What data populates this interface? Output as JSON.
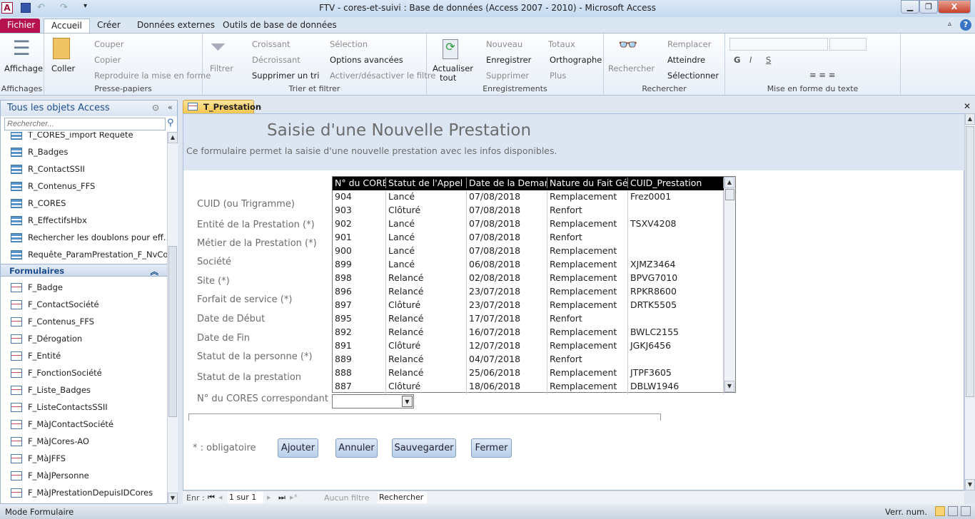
{
  "window": {
    "title": "FTV - cores-et-suivi : Base de données (Access 2007 - 2010)  -  Microsoft Access",
    "app_icon": "A"
  },
  "tabs": [
    "Fichier",
    "Accueil",
    "Créer",
    "Données externes",
    "Outils de base de données"
  ],
  "ribbon": {
    "affichages": {
      "button": "Affichage",
      "label": "Affichages"
    },
    "presse": {
      "coller": "Coller",
      "couper": "Couper",
      "copier": "Copier",
      "reproduire": "Reproduire la mise en forme",
      "label": "Presse-papiers"
    },
    "trier": {
      "filtrer": "Filtrer",
      "croissant": "Croissant",
      "decroissant": "Décroissant",
      "supprimer_tri": "Supprimer un tri",
      "selection": "Sélection",
      "options": "Options avancées",
      "activer": "Activer/désactiver le filtre",
      "label": "Trier et filtrer"
    },
    "enreg": {
      "actualiser": "Actualiser",
      "tout": "tout",
      "nouveau": "Nouveau",
      "enregistrer": "Enregistrer",
      "supprimer": "Supprimer",
      "totaux": "Totaux",
      "orthographe": "Orthographe",
      "plus": "Plus",
      "label": "Enregistrements"
    },
    "rechercher": {
      "button": "Rechercher",
      "remplacer": "Remplacer",
      "atteindre": "Atteindre",
      "selectionner": "Sélectionner",
      "label": "Rechercher"
    },
    "mise_en_forme": {
      "bold": "G",
      "italic": "I",
      "underline": "S",
      "label": "Mise en forme du texte"
    }
  },
  "nav": {
    "title": "Tous les objets Access",
    "search_placeholder": "Rechercher...",
    "queries": [
      "T_CORES_import Requête",
      "R_Badges",
      "R_ContactSSII",
      "R_Contenus_FFS",
      "R_CORES",
      "R_EffectifsHbx",
      "Rechercher les doublons pour eff...",
      "Requête_ParamPrestation_F_NvCo..."
    ],
    "forms_section": "Formulaires",
    "forms": [
      "F_Badge",
      "F_ContactSociété",
      "F_Contenus_FFS",
      "F_Dérogation",
      "F_Entité",
      "F_FonctionSociété",
      "F_Liste_Badges",
      "F_ListeContactsSSII",
      "F_MàJContactSociété",
      "F_MàJCores-AO",
      "F_MàJFFS",
      "F_MàJPersonne",
      "F_MàJPrestationDepuisIDCores"
    ]
  },
  "doc_tab": "T_Prestation",
  "form": {
    "title": "Saisie d'une Nouvelle Prestation",
    "subtitle": "Ce formulaire permet la saisie d'une nouvelle prestation avec les infos disponibles.",
    "labels": [
      "CUID (ou Trigramme)",
      "Entité de la Prestation (*)",
      "Métier de la Prestation (*)",
      "Société",
      "Site (*)",
      "Forfait de service (*)",
      "Date de Début",
      "Date de Fin",
      "Statut de la personne (*)",
      "Statut de la prestation",
      "N° du CORES correspondant"
    ],
    "required_note": "* : obligatoire",
    "buttons": [
      "Ajouter",
      "Annuler",
      "Sauvegarder",
      "Fermer"
    ],
    "list": {
      "columns": [
        "N° du CORES",
        "Statut de l'Appel d'",
        "Date de la Demande",
        "Nature du Fait Gén",
        "CUID_Prestation"
      ],
      "rows": [
        [
          "904",
          "Lancé",
          "07/08/2018",
          "Remplacement",
          "Frez0001"
        ],
        [
          "903",
          "Clôturé",
          "07/08/2018",
          "Renfort",
          ""
        ],
        [
          "902",
          "Lancé",
          "07/08/2018",
          "Remplacement",
          "TSXV4208"
        ],
        [
          "901",
          "Lancé",
          "07/08/2018",
          "Renfort",
          ""
        ],
        [
          "900",
          "Lancé",
          "07/08/2018",
          "Remplacement",
          ""
        ],
        [
          "899",
          "Lancé",
          "06/08/2018",
          "Remplacement",
          "XJMZ3464"
        ],
        [
          "898",
          "Relancé",
          "02/08/2018",
          "Remplacement",
          "BPVG7010"
        ],
        [
          "896",
          "Relancé",
          "23/07/2018",
          "Remplacement",
          "RPKR8600"
        ],
        [
          "897",
          "Clôturé",
          "23/07/2018",
          "Remplacement",
          "DRTK5505"
        ],
        [
          "895",
          "Relancé",
          "17/07/2018",
          "Renfort",
          ""
        ],
        [
          "892",
          "Relancé",
          "16/07/2018",
          "Remplacement",
          "BWLC2155"
        ],
        [
          "891",
          "Clôturé",
          "12/07/2018",
          "Remplacement",
          "JGKJ6456"
        ],
        [
          "889",
          "Relancé",
          "04/07/2018",
          "Renfort",
          ""
        ],
        [
          "888",
          "Relancé",
          "25/06/2018",
          "Remplacement",
          "JTPF3605"
        ],
        [
          "887",
          "Clôturé",
          "18/06/2018",
          "Remplacement",
          "DBLW1946"
        ]
      ]
    }
  },
  "record_nav": {
    "label": "Enr :",
    "position": "1 sur 1",
    "filter": "Aucun filtre",
    "search": "Rechercher"
  },
  "status": {
    "mode": "Mode Formulaire",
    "numlock": "Verr. num."
  }
}
